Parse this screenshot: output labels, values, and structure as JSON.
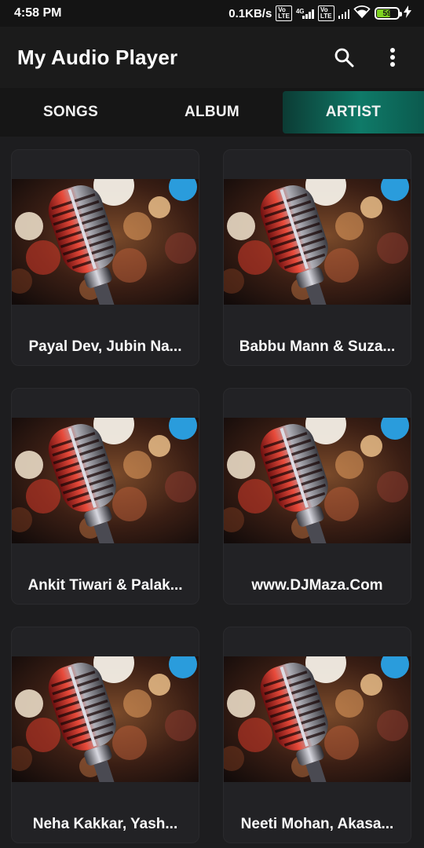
{
  "status_bar": {
    "time": "4:58 PM",
    "speed": "0.1KB/s",
    "volte_label": "Vo\nLTE",
    "network_tag": "4G",
    "battery_level": "59"
  },
  "app_bar": {
    "title": "My Audio Player",
    "search_icon": "search-icon",
    "menu_icon": "more-vert-icon"
  },
  "tabs": [
    {
      "label": "SONGS",
      "active": false
    },
    {
      "label": "ALBUM",
      "active": false
    },
    {
      "label": "ARTIST",
      "active": true
    }
  ],
  "artists": [
    {
      "name": "Payal Dev, Jubin Na..."
    },
    {
      "name": "Babbu Mann & Suza..."
    },
    {
      "name": "Ankit Tiwari & Palak..."
    },
    {
      "name": "www.DJMaza.Com"
    },
    {
      "name": "Neha Kakkar, Yash..."
    },
    {
      "name": "Neeti Mohan, Akasa..."
    }
  ],
  "colors": {
    "accent": "#0f7a68",
    "background": "#1d1d1f",
    "card": "#222225"
  }
}
